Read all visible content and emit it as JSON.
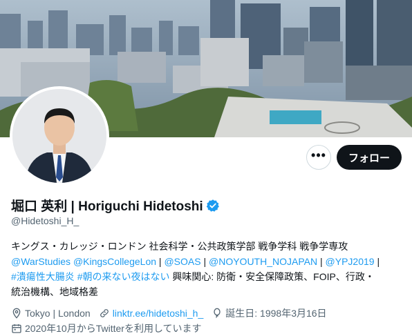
{
  "profile": {
    "display_name": "堀口 英利 | Horiguchi Hidetoshi",
    "handle": "@Hidetoshi_H_",
    "verified": true
  },
  "actions": {
    "more_label": "•••",
    "follow_label": "フォロー"
  },
  "bio": {
    "line1": "キングス・カレッジ・ロンドン 社会科学・公共政策学部 戦争学科 戦争学専攻",
    "line2": {
      "link1": "@WarStudies",
      "link2": "@KingsCollegeLon",
      "sep1": " | ",
      "link3": "@SOAS",
      "sep2": " | ",
      "link4": "@NOYOUTH_NOJAPAN",
      "sep3": " | ",
      "link5": "@YPJ2019",
      "sep4": " |"
    },
    "line3": {
      "tag1": "#潰瘍性大腸炎",
      "tag2": "#朝の来ない夜はない",
      "text": " 興味関心: 防衛・安全保障政策、FOIP、行政・"
    },
    "line4": "統治機構、地域格差"
  },
  "meta": {
    "location": "Tokyo | London",
    "website": "linktr.ee/hidetoshi_h_",
    "birthday": "誕生日: 1998年3月16日",
    "joined": "2020年10月からTwitterを利用しています"
  },
  "icons": {
    "verified": "verified-badge-icon",
    "location": "location-pin-icon",
    "link": "link-icon",
    "birthday": "balloon-icon",
    "joined": "calendar-icon",
    "more": "more-dots-icon"
  },
  "colors": {
    "accent": "#1d9bf0",
    "text": "#0f1419",
    "muted": "#536471",
    "follow_bg": "#0f1419"
  }
}
